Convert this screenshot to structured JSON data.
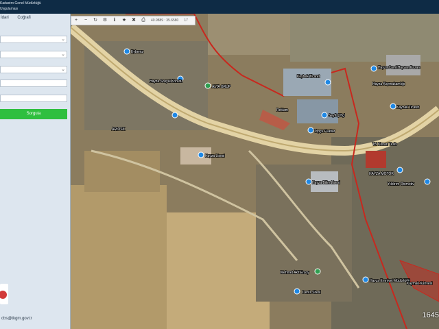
{
  "header": {
    "line1": "Kadastro Genel Müdürlüğü",
    "line2": "Uygulaması"
  },
  "sidebar": {
    "tabs": [
      "İdari",
      "Coğrafi"
    ],
    "query_label": "Sorgula",
    "email": "cbs@tkgm.gov.tr"
  },
  "toolbar": {
    "coordinate": "40.9889 : 35.6580",
    "zoom_level": "17"
  },
  "map": {
    "scale_text": "1645",
    "labels": [
      "Eybemz",
      "Hayza Sosyal Konutu",
      "ALTA GRUP",
      "Keybek Ticaret",
      "Hayza Cami Hayvan Pazarı",
      "Hayza Kaymakamlığı",
      "Seyfi Çiftçi",
      "Topçu Fuatlar",
      "Kaynak Ticaret",
      "Reklam",
      "ARIOSK",
      "Hayza Lisesi",
      "Hayza Bilim Lisesi",
      "Yol Kenarı Tesis",
      "HAYZA MOTOR",
      "Yıldırım Otomotiv",
      "Mehmet Akif Ersoy",
      "Deniz Sitesi",
      "Hayza Emniyet Müdürlüğü",
      "Kaymak Kahvesi"
    ]
  }
}
